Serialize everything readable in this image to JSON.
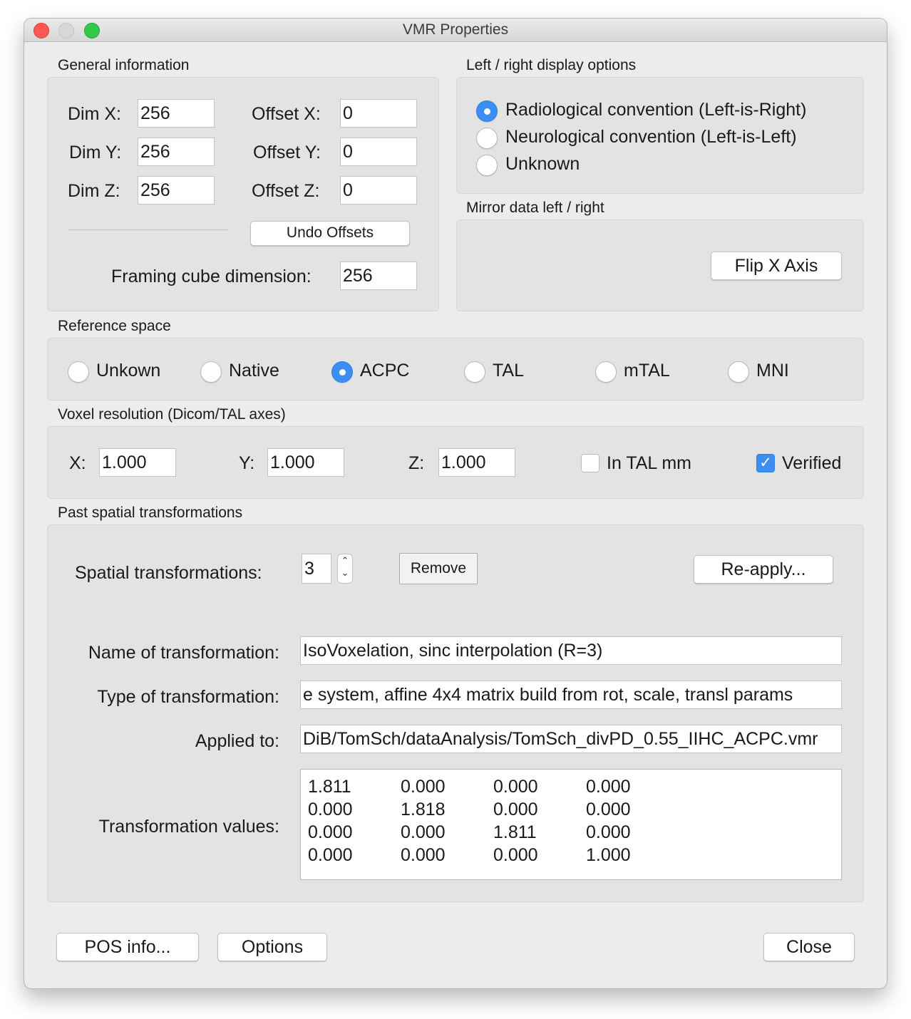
{
  "window": {
    "title": "VMR Properties"
  },
  "general": {
    "heading": "General information",
    "dim_x_label": "Dim X:",
    "dim_x": "256",
    "dim_y_label": "Dim Y:",
    "dim_y": "256",
    "dim_z_label": "Dim Z:",
    "dim_z": "256",
    "offset_x_label": "Offset X:",
    "offset_x": "0",
    "offset_y_label": "Offset Y:",
    "offset_y": "0",
    "offset_z_label": "Offset Z:",
    "offset_z": "0",
    "undo_offsets": "Undo Offsets",
    "framing_label": "Framing cube dimension:",
    "framing": "256"
  },
  "display": {
    "heading": "Left / right display options",
    "options": [
      "Radiological convention (Left-is-Right)",
      "Neurological convention (Left-is-Left)",
      "Unknown"
    ],
    "selected": "Radiological convention (Left-is-Right)"
  },
  "mirror": {
    "heading": "Mirror data left / right",
    "flip_button": "Flip X Axis"
  },
  "reference": {
    "heading": "Reference space",
    "options": [
      "Unkown",
      "Native",
      "ACPC",
      "TAL",
      "mTAL",
      "MNI"
    ],
    "selected": "ACPC"
  },
  "voxel": {
    "heading": "Voxel resolution (Dicom/TAL axes)",
    "x_label": "X:",
    "x": "1.000",
    "y_label": "Y:",
    "y": "1.000",
    "z_label": "Z:",
    "z": "1.000",
    "in_tal_label": "In TAL mm",
    "in_tal_checked": false,
    "verified_label": "Verified",
    "verified_checked": true
  },
  "past": {
    "heading": "Past spatial transformations",
    "count_label": "Spatial transformations:",
    "count": "3",
    "remove_button": "Remove",
    "reapply_button": "Re-apply...",
    "name_label": "Name of transformation:",
    "name": "IsoVoxelation, sinc interpolation (R=3)",
    "type_label": "Type of transformation:",
    "type": "e system, affine 4x4 matrix build from rot, scale, transl params",
    "applied_label": "Applied to:",
    "applied": "DiB/TomSch/dataAnalysis/TomSch_divPD_0.55_IIHC_ACPC.vmr",
    "values_label": "Transformation values:",
    "matrix": [
      [
        "1.811",
        "0.000",
        "0.000",
        "0.000"
      ],
      [
        "0.000",
        "1.818",
        "0.000",
        "0.000"
      ],
      [
        "0.000",
        "0.000",
        "1.811",
        "0.000"
      ],
      [
        "0.000",
        "0.000",
        "0.000",
        "1.000"
      ]
    ]
  },
  "footer": {
    "pos_info": "POS info...",
    "options": "Options",
    "close": "Close"
  },
  "colors": {
    "accent": "#3b8ff4",
    "window_bg": "#ececec",
    "group_bg": "#e3e3e3"
  }
}
